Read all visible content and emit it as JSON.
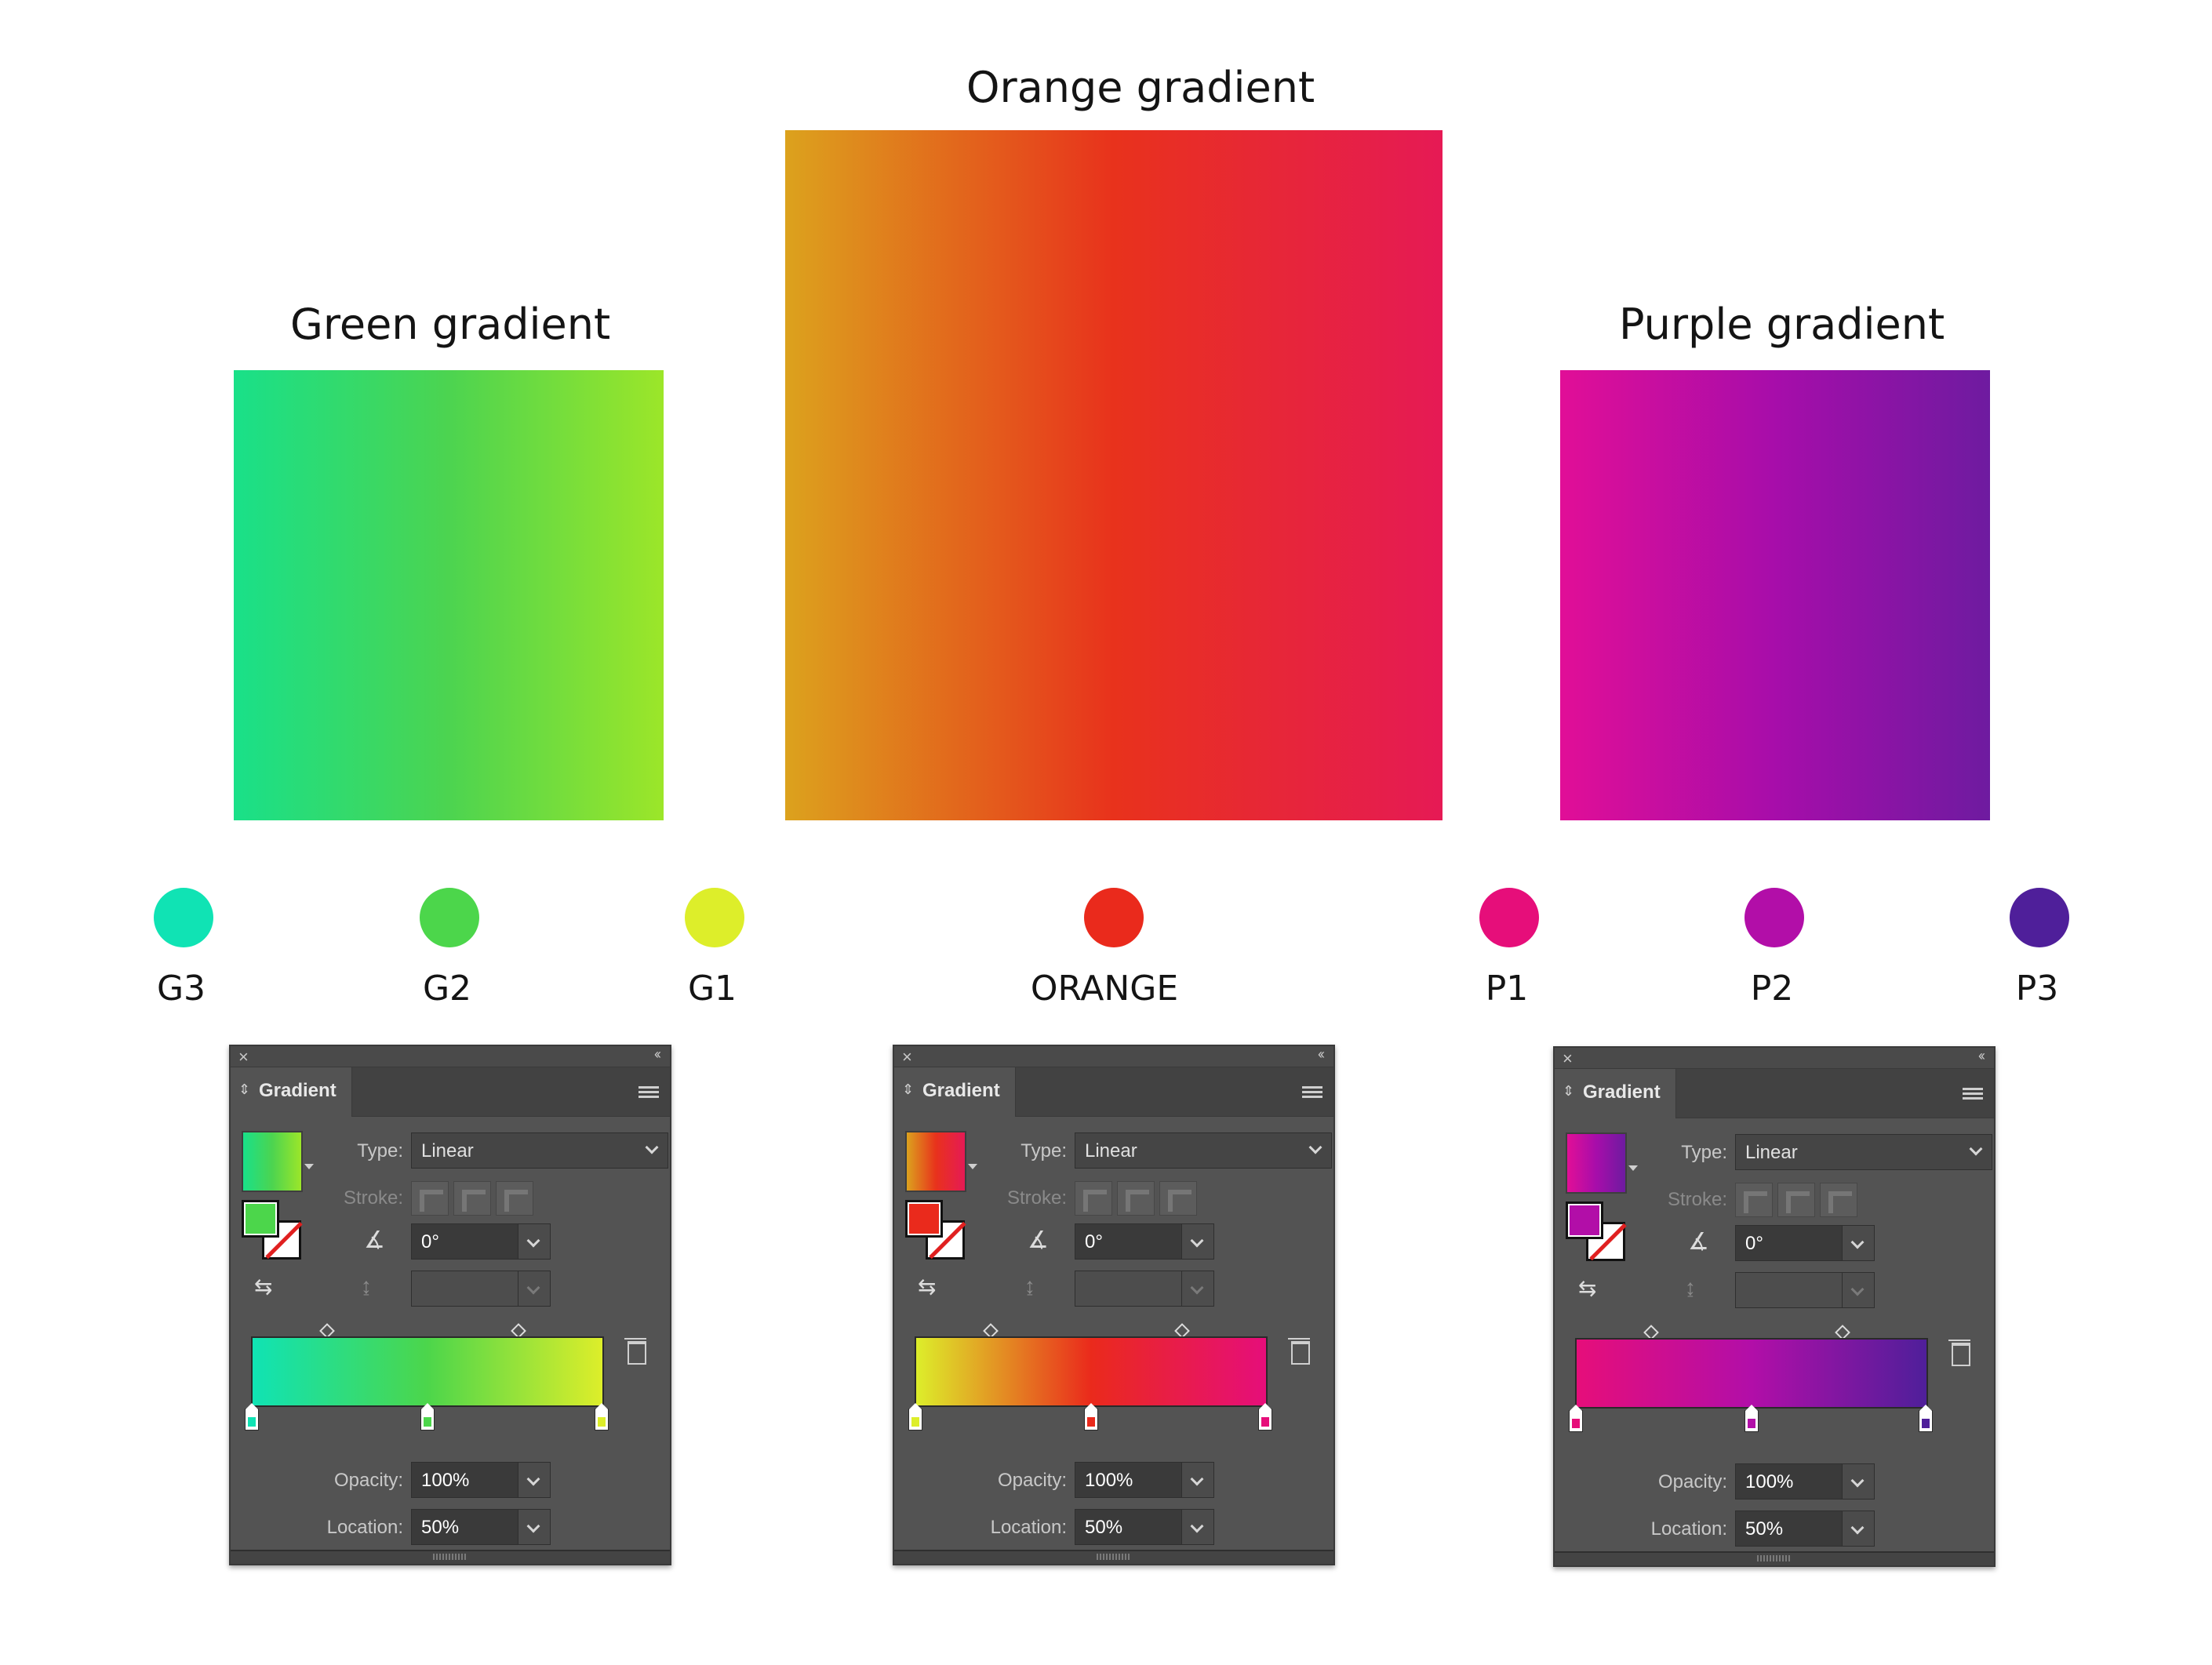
{
  "titles": {
    "green": "Green gradient",
    "orange": "Orange gradient",
    "purple": "Purple gradient"
  },
  "swatches": [
    {
      "label": "G3",
      "color": "#10E3B4"
    },
    {
      "label": "G2",
      "color": "#4CD64B"
    },
    {
      "label": "G1",
      "color": "#DDEE2A"
    },
    {
      "label": "ORANGE",
      "color": "#EA2A1C"
    },
    {
      "label": "P1",
      "color": "#E60E7A"
    },
    {
      "label": "P2",
      "color": "#B20EA8"
    },
    {
      "label": "P3",
      "color": "#4F1F9A"
    }
  ],
  "gradients": {
    "green": [
      "#19E089",
      "#4CD450",
      "#9CE629"
    ],
    "orange": [
      "#DCA21D",
      "#E8321C",
      "#E61A55"
    ],
    "purple": [
      "#E10E97",
      "#A70DAA",
      "#6E1BA0"
    ]
  },
  "panel": {
    "tab_label": "Gradient",
    "close_glyph": "×",
    "collapse_glyph": "‹‹",
    "type_label": "Type:",
    "type_value": "Linear",
    "stroke_label": "Stroke:",
    "angle_value": "0°",
    "opacity_label": "Opacity:",
    "opacity_value": "100%",
    "location_label": "Location:",
    "location_value": "50%"
  },
  "panels": [
    {
      "name": "green",
      "fill_color": "#4CD64B",
      "stops": [
        "#10E3B4",
        "#4CD64B",
        "#DDEE2A"
      ]
    },
    {
      "name": "orange",
      "fill_color": "#EA2A1C",
      "stops": [
        "#DDEE2A",
        "#EA2A1C",
        "#E60E7A"
      ]
    },
    {
      "name": "purple",
      "fill_color": "#B20EA8",
      "stops": [
        "#E60E7A",
        "#B20EA8",
        "#4F1F9A"
      ]
    }
  ]
}
